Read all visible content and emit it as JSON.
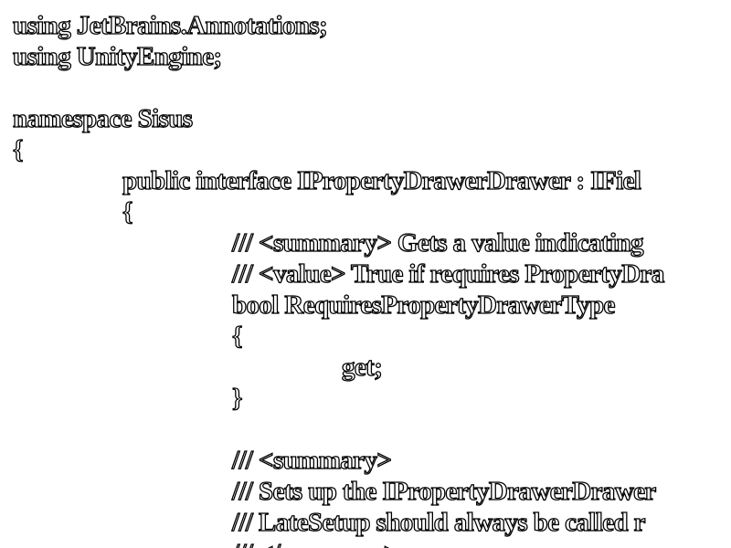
{
  "code": {
    "lines": [
      {
        "indent": 0,
        "text": "using JetBrains.Annotations;"
      },
      {
        "indent": 0,
        "text": "using UnityEngine;"
      },
      {
        "indent": 0,
        "text": ""
      },
      {
        "indent": 0,
        "text": "namespace Sisus"
      },
      {
        "indent": 0,
        "text": "{"
      },
      {
        "indent": 1,
        "text": "public interface IPropertyDrawerDrawer : IFiel"
      },
      {
        "indent": 1,
        "text": "{"
      },
      {
        "indent": 2,
        "text": "/// <summary> Gets a value indicating"
      },
      {
        "indent": 2,
        "text": "/// <value> True if requires PropertyDra"
      },
      {
        "indent": 2,
        "text": "bool RequiresPropertyDrawerType"
      },
      {
        "indent": 2,
        "text": "{"
      },
      {
        "indent": 3,
        "text": "get;"
      },
      {
        "indent": 2,
        "text": "}"
      },
      {
        "indent": 0,
        "text": ""
      },
      {
        "indent": 2,
        "text": "/// <summary>"
      },
      {
        "indent": 2,
        "text": "/// Sets up the IPropertyDrawerDrawer"
      },
      {
        "indent": 2,
        "text": "/// LateSetup should always be called r"
      },
      {
        "indent": 2,
        "text": "/// </summary>"
      }
    ]
  }
}
